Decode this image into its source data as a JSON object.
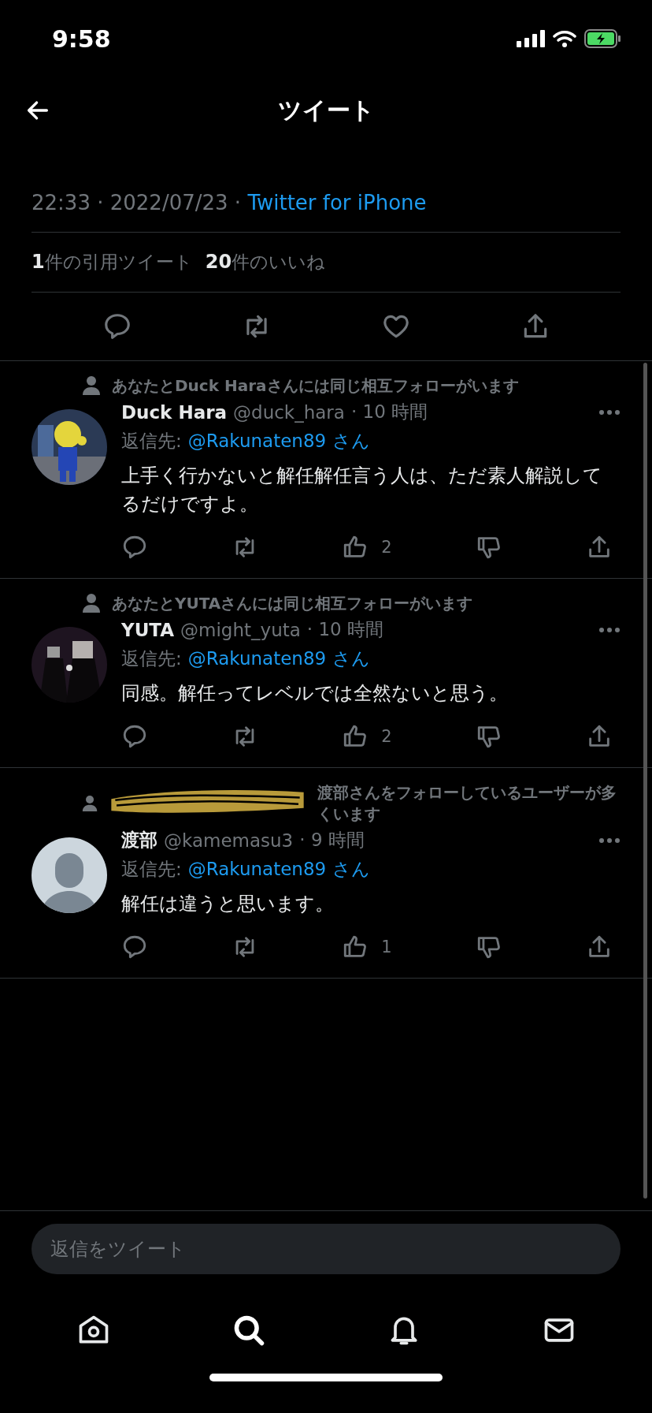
{
  "status_bar": {
    "time": "9:58"
  },
  "header": {
    "title": "ツイート"
  },
  "tweet_meta": {
    "time": "22:33 · 2022/07/23 · ",
    "source": "Twitter for iPhone"
  },
  "stats": [
    {
      "count": "1",
      "label": "件の引用ツイート"
    },
    {
      "count": "20",
      "label": "件のいいね"
    }
  ],
  "replies": [
    {
      "context": "あなたとDuck Haraさんには同じ相互フォローがいます",
      "redacted": false,
      "name": "Duck Hara",
      "handle": "@duck_hara",
      "time": "· 10 時間",
      "reply_label": "返信先:",
      "reply_to": "@Rakunaten89 さん",
      "text": "上手く行かないと解任解任言う人は、ただ素人解説してるだけですよ。",
      "likes": "2"
    },
    {
      "context": "あなたとYUTAさんには同じ相互フォローがいます",
      "redacted": false,
      "name": "YUTA",
      "handle": "@might_yuta",
      "time": "· 10 時間",
      "reply_label": "返信先:",
      "reply_to": "@Rakunaten89 さん",
      "text": "同感。解任ってレベルでは全然ないと思う。",
      "likes": "2"
    },
    {
      "context": "渡部さんをフォローしているユーザーが多くいます",
      "redacted": true,
      "name": "渡部",
      "handle": "@kamemasu3",
      "time": "· 9 時間",
      "reply_label": "返信先:",
      "reply_to": "@Rakunaten89 さん",
      "text": "解任は違うと思います。",
      "likes": "1"
    }
  ],
  "composer": {
    "placeholder": "返信をツイート"
  }
}
